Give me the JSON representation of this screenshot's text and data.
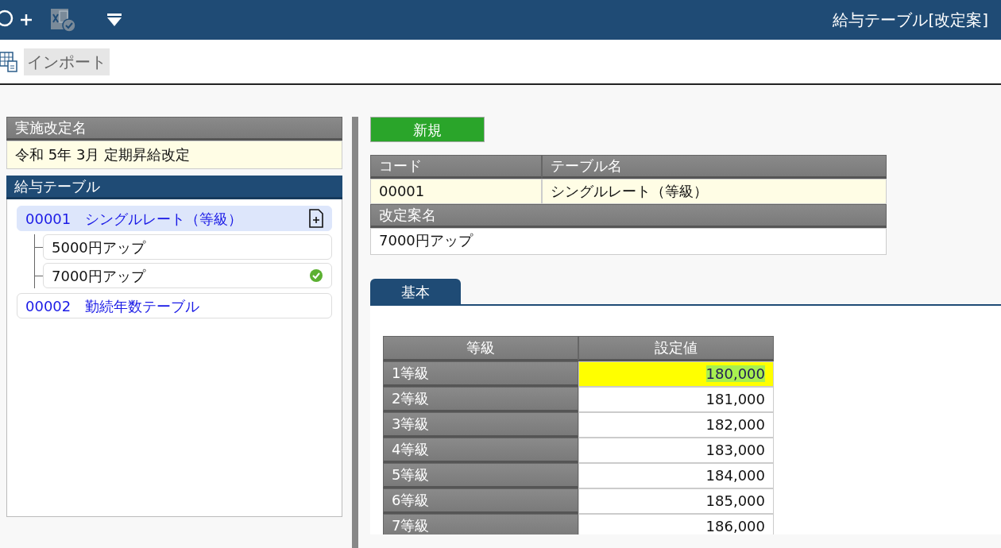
{
  "window": {
    "title": "給与テーブル[改定案]"
  },
  "toolbar": {
    "import_button": "インポート"
  },
  "revision": {
    "label": "実施改定名",
    "value": "令和  5年  3月  定期昇給改定"
  },
  "salary_tables": {
    "title": "給与テーブル",
    "items": [
      {
        "code": "00001",
        "name": "シングルレート（等級）",
        "selected": true,
        "children": [
          {
            "name": "5000円アップ",
            "applied": false
          },
          {
            "name": "7000円アップ",
            "applied": true
          }
        ]
      },
      {
        "code": "00002",
        "name": "勤続年数テーブル",
        "selected": false
      }
    ]
  },
  "new_button": "新規",
  "detail": {
    "code_label": "コード",
    "name_label": "テーブル名",
    "code": "00001",
    "name": "シングルレート（等級）",
    "plan_label": "改定案名",
    "plan": "7000円アップ"
  },
  "tabs": [
    {
      "label": "基本",
      "selected": true
    }
  ],
  "grade_table": {
    "columns": [
      "等級",
      "設定値"
    ],
    "rows": [
      {
        "grade": "1等級",
        "value": "180,000",
        "selected": true
      },
      {
        "grade": "2等級",
        "value": "181,000",
        "selected": false
      },
      {
        "grade": "3等級",
        "value": "182,000",
        "selected": false
      },
      {
        "grade": "4等級",
        "value": "183,000",
        "selected": false
      },
      {
        "grade": "5等級",
        "value": "184,000",
        "selected": false
      },
      {
        "grade": "6等級",
        "value": "185,000",
        "selected": false
      },
      {
        "grade": "7等級",
        "value": "186,000",
        "selected": false
      }
    ]
  }
}
